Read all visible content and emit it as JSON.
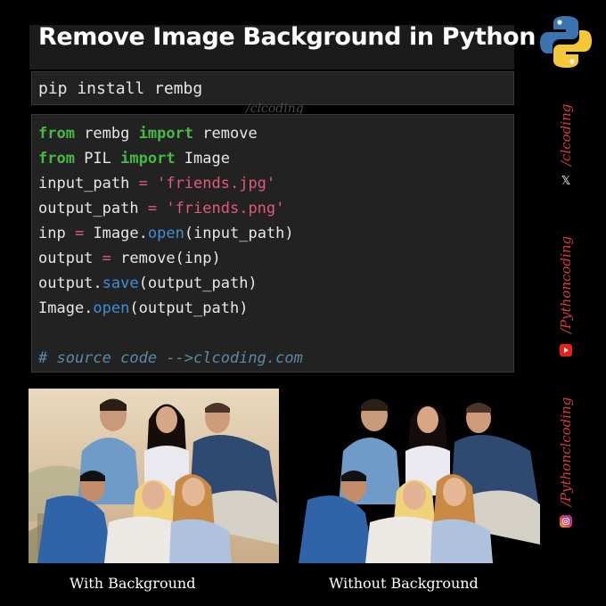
{
  "title": "Remove Image Background in Python",
  "install_command": "pip install rembg",
  "watermark": "/clcoding",
  "code_lines": [
    [
      {
        "t": "from",
        "c": "kw"
      },
      {
        "t": " rembg ",
        "c": ""
      },
      {
        "t": "import",
        "c": "kw"
      },
      {
        "t": " remove",
        "c": ""
      }
    ],
    [
      {
        "t": "from",
        "c": "kw"
      },
      {
        "t": " PIL ",
        "c": ""
      },
      {
        "t": "import",
        "c": "kw"
      },
      {
        "t": " Image",
        "c": ""
      }
    ],
    [
      {
        "t": "input_path ",
        "c": ""
      },
      {
        "t": "=",
        "c": "op"
      },
      {
        "t": " ",
        "c": ""
      },
      {
        "t": "'friends.jpg'",
        "c": "str"
      }
    ],
    [
      {
        "t": "output_path ",
        "c": ""
      },
      {
        "t": "=",
        "c": "op"
      },
      {
        "t": " ",
        "c": ""
      },
      {
        "t": "'friends.png'",
        "c": "str"
      }
    ],
    [
      {
        "t": "inp ",
        "c": ""
      },
      {
        "t": "=",
        "c": "op"
      },
      {
        "t": " Image.",
        "c": ""
      },
      {
        "t": "open",
        "c": "fn"
      },
      {
        "t": "(input_path)",
        "c": ""
      }
    ],
    [
      {
        "t": "output ",
        "c": ""
      },
      {
        "t": "=",
        "c": "op"
      },
      {
        "t": " remove(inp)",
        "c": ""
      }
    ],
    [
      {
        "t": "output.",
        "c": ""
      },
      {
        "t": "save",
        "c": "fn"
      },
      {
        "t": "(output_path)",
        "c": ""
      }
    ],
    [
      {
        "t": "Image.",
        "c": ""
      },
      {
        "t": "open",
        "c": "fn"
      },
      {
        "t": "(output_path)",
        "c": ""
      }
    ],
    [],
    [
      {
        "t": "# source code -->clcoding.com",
        "c": "cm"
      }
    ]
  ],
  "side_labels": {
    "x_handle": "/clcoding",
    "youtube_handle": "/Pythoncoding",
    "instagram_handle": "/Pythonclcoding"
  },
  "icons": {
    "logo": "python-logo-icon",
    "x": "x-logo-icon",
    "youtube": "youtube-icon",
    "instagram": "instagram-icon"
  },
  "captions": {
    "left": "With Background",
    "right": "Without Background"
  },
  "colors": {
    "keyword": "#44b944",
    "string": "#e05a7a",
    "function": "#3d8fd6",
    "comment": "#5b8aa6",
    "side_text": "#d63a3a",
    "python_blue": "#3a75b0",
    "python_yellow": "#f7c73a"
  }
}
